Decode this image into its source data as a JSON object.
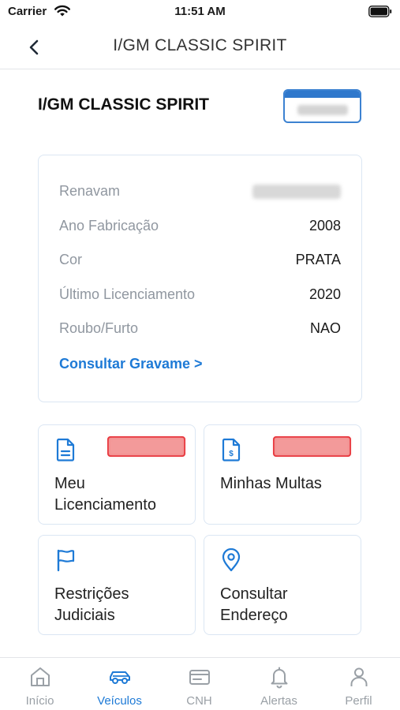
{
  "status_bar": {
    "carrier": "Carrier",
    "time": "11:51 AM"
  },
  "nav": {
    "title": "I/GM CLASSIC SPIRIT"
  },
  "vehicle": {
    "title": "I/GM CLASSIC SPIRIT",
    "details": [
      {
        "label": "Renavam",
        "value": ""
      },
      {
        "label": "Ano Fabricação",
        "value": "2008"
      },
      {
        "label": "Cor",
        "value": "PRATA"
      },
      {
        "label": "Último Licenciamento",
        "value": "2020"
      },
      {
        "label": "Roubo/Furto",
        "value": "NAO"
      }
    ],
    "gravame_link": "Consultar Gravame >"
  },
  "tiles": [
    {
      "label": "Meu Licenciamento",
      "icon": "document-icon"
    },
    {
      "label": "Minhas Multas",
      "icon": "fine-document-icon"
    },
    {
      "label": "Restrições Judiciais",
      "icon": "flag-icon"
    },
    {
      "label": "Consultar Endereço",
      "icon": "location-pin-icon"
    }
  ],
  "tab_bar": {
    "active": "Veículos",
    "items": [
      {
        "label": "Início",
        "icon": "home-icon"
      },
      {
        "label": "Veículos",
        "icon": "car-icon"
      },
      {
        "label": "CNH",
        "icon": "license-card-icon"
      },
      {
        "label": "Alertas",
        "icon": "bell-icon"
      },
      {
        "label": "Perfil",
        "icon": "person-icon"
      }
    ]
  },
  "colors": {
    "accent": "#1e7ad6",
    "badge_border": "#e51b23",
    "muted_text": "#9097a0"
  }
}
